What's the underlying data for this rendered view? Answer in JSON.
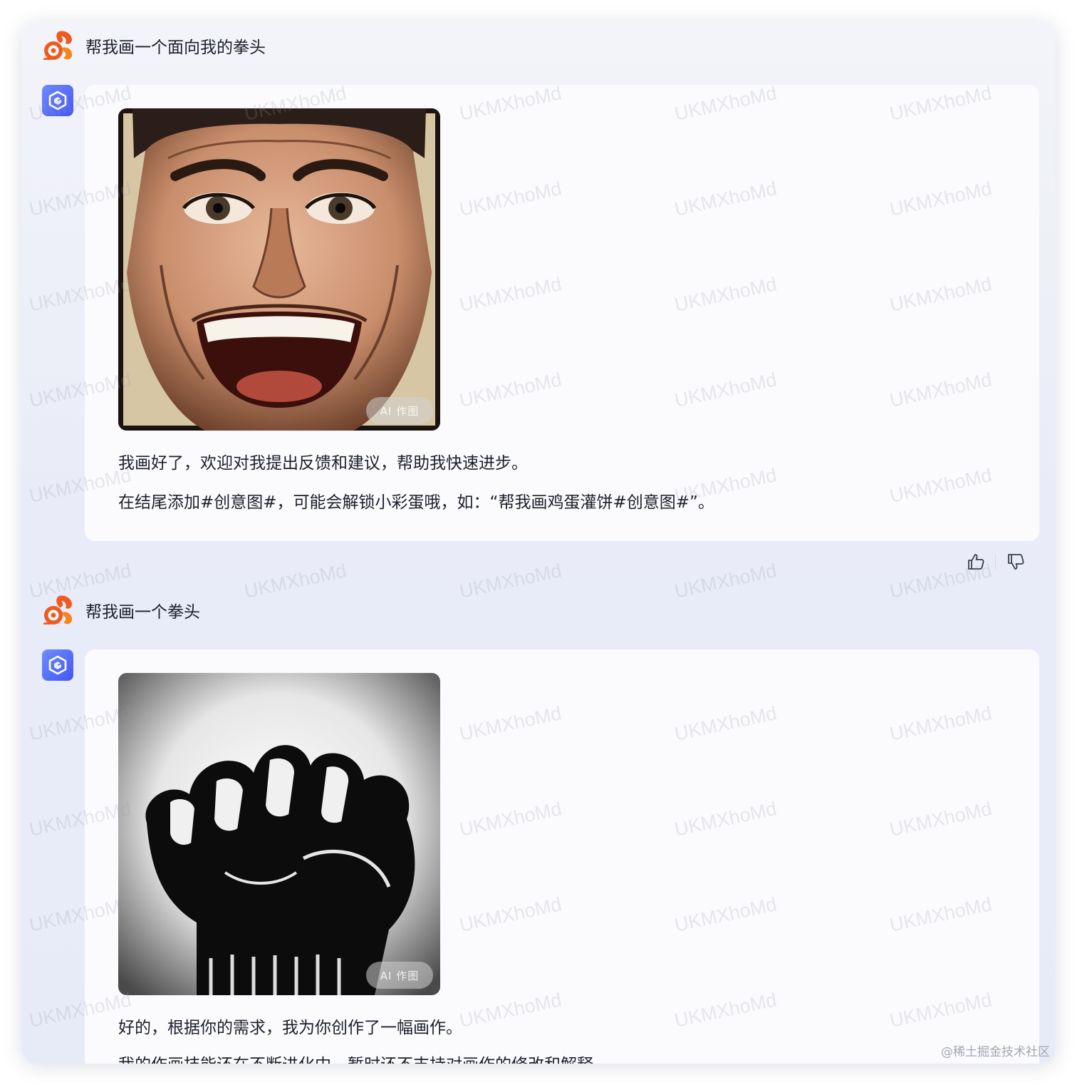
{
  "conversation": [
    {
      "user_prompt": "帮我画一个面向我的拳头",
      "image_badge": "AI 作图",
      "reply_lines": [
        "我画好了，欢迎对我提出反馈和建议，帮助我快速进步。",
        "在结尾添加#创意图#，可能会解锁小彩蛋哦，如：“帮我画鸡蛋灌饼#创意图#”。"
      ]
    },
    {
      "user_prompt": "帮我画一个拳头",
      "image_badge": "AI 作图",
      "reply_lines": [
        "好的，根据你的需求，我为你创作了一幅画作。",
        "我的作画技能还在不断进化中，暂时还不支持对画作的修改和解释。"
      ]
    }
  ],
  "watermark_text": "UKMXhoMd",
  "footer_mark": "@稀土掘金技术社区",
  "icons": {
    "user_avatar": "uc-squirrel-logo-icon",
    "bot_avatar": "cube-logo-icon",
    "feedback": [
      "thumbs-up-icon",
      "thumbs-down-icon"
    ]
  },
  "colors": {
    "logo_orange": "#ef5a22",
    "bot_avatar": "#5168f5",
    "text": "#1c1f2b"
  }
}
